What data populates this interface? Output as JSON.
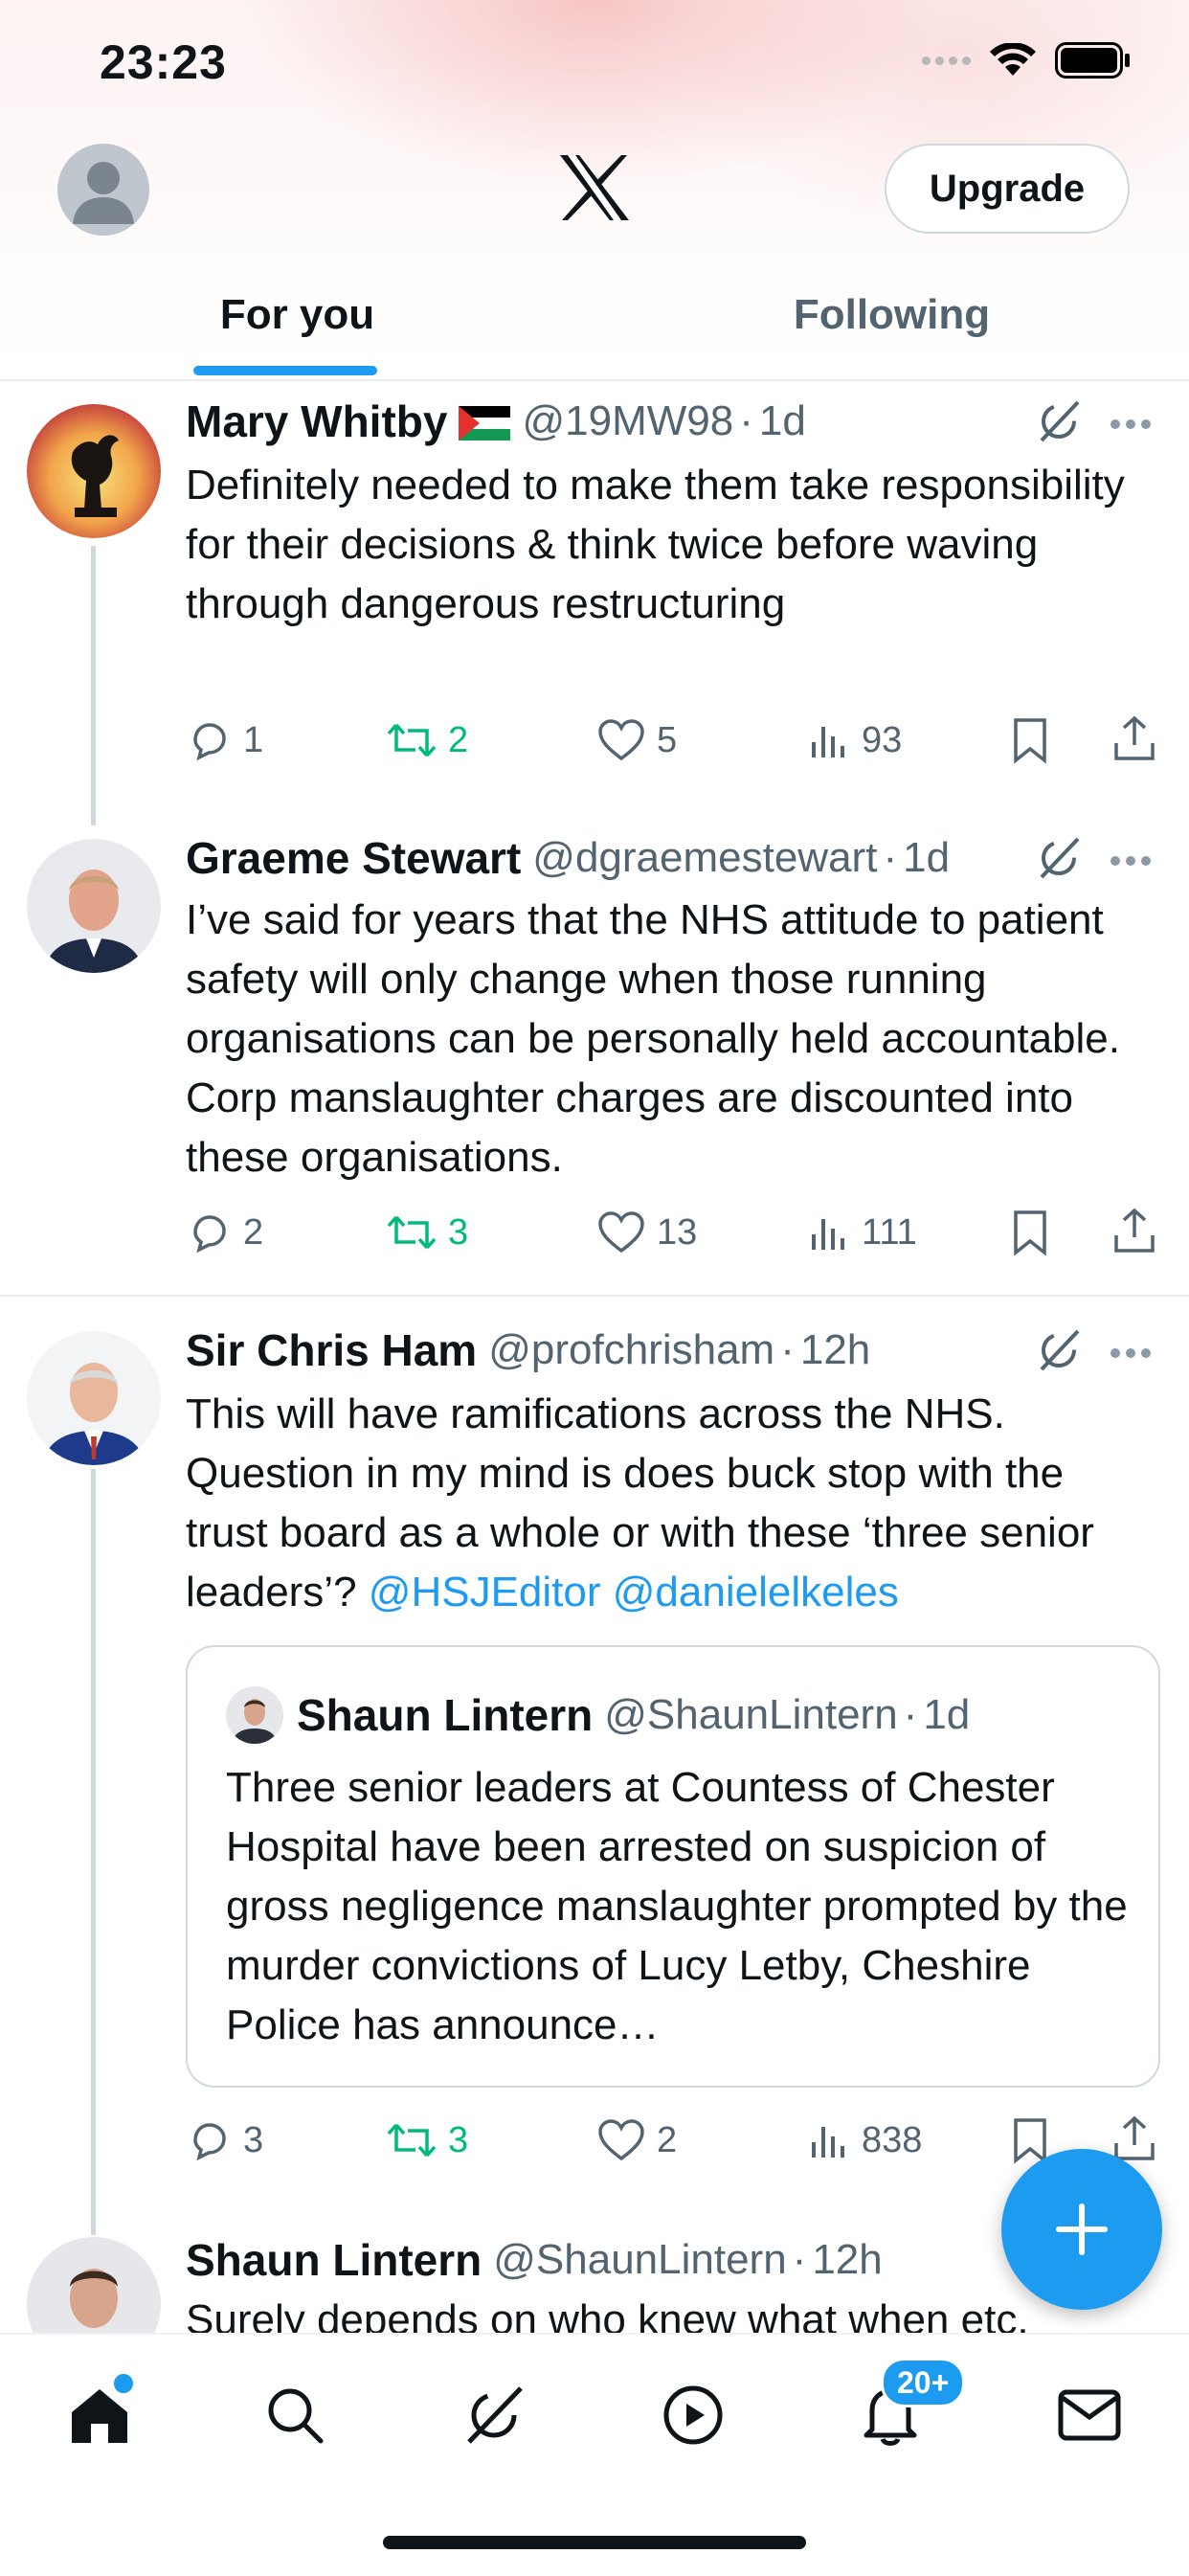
{
  "status_bar": {
    "time": "23:23"
  },
  "header": {
    "upgrade_label": "Upgrade",
    "tabs": [
      {
        "label": "For you",
        "active": true
      },
      {
        "label": "Following",
        "active": false
      }
    ]
  },
  "tweets": [
    {
      "name": "Mary Whitby",
      "handle": "@19MW98",
      "time": "1d",
      "text": "Definitely needed to make them take responsibility for their decisions & think twice before waving through dangerous restructuring",
      "replies": "1",
      "reposts": "2",
      "likes": "5",
      "views": "93"
    },
    {
      "name": "Graeme Stewart",
      "handle": "@dgraemestewart",
      "time": "1d",
      "text": "I’ve said for years that the NHS attitude to patient safety will only change when those running organisations can be personally held accountable. Corp manslaughter charges are discounted into these organisations.",
      "replies": "2",
      "reposts": "3",
      "likes": "13",
      "views": "111"
    },
    {
      "name": "Sir Chris Ham",
      "handle": "@profchrisham",
      "time": "12h",
      "text": "This will have ramifications across the NHS. Question in my mind is does buck stop with the trust board as a whole or with these ‘three senior leaders’? ",
      "mention1": "@HSJEditor",
      "mention2": "@danielelkeles",
      "quote": {
        "name": "Shaun Lintern",
        "handle": "@ShaunLintern",
        "time": "1d",
        "text": "Three senior leaders at Countess of Chester Hospital have been arrested on suspicion of gross negligence manslaughter prompted by the murder convictions of Lucy Letby, Cheshire Police has announce…"
      },
      "replies": "3",
      "reposts": "3",
      "likes": "2",
      "views": "838"
    },
    {
      "name": "Shaun Lintern",
      "handle": "@ShaunLintern",
      "time": "12h",
      "text": "Surely depends on who knew what when etc."
    }
  ],
  "bottom_nav": {
    "items": [
      "home-icon",
      "search-icon",
      "grok-icon",
      "video-icon",
      "notifications-icon",
      "messages-icon"
    ],
    "notifications_badge": "20+"
  },
  "colors": {
    "accent": "#1d9bf0",
    "repost": "#00ba7c",
    "secondary_text": "#536471"
  }
}
